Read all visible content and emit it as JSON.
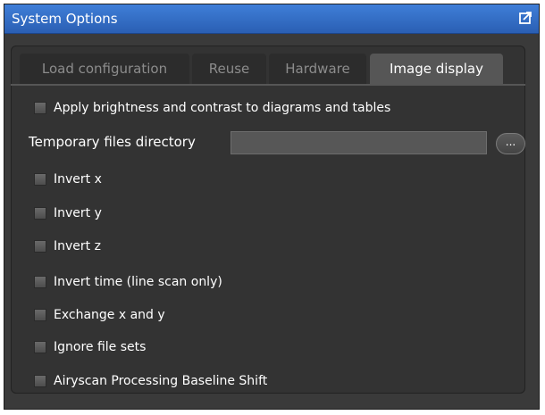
{
  "window": {
    "title": "System Options",
    "undock_icon": "undock-icon"
  },
  "tabs": [
    {
      "label": "Load configuration",
      "active": false
    },
    {
      "label": "Reuse",
      "active": false
    },
    {
      "label": "Hardware",
      "active": false
    },
    {
      "label": "Image display",
      "active": true
    }
  ],
  "options": {
    "apply_brightness": {
      "label": "Apply brightness and contrast to diagrams and tables",
      "checked": false
    },
    "temp_dir": {
      "label": "Temporary files directory",
      "value": "",
      "browse_label": "..."
    },
    "invert_x": {
      "label": "Invert x",
      "checked": false
    },
    "invert_y": {
      "label": "Invert y",
      "checked": false
    },
    "invert_z": {
      "label": "Invert z",
      "checked": false
    },
    "invert_time": {
      "label": "Invert time (line scan only)",
      "checked": false
    },
    "exchange_xy": {
      "label": "Exchange x and y",
      "checked": false
    },
    "ignore_file_sets": {
      "label": "Ignore file sets",
      "checked": false
    },
    "airyscan_shift": {
      "label": "Airyscan Processing Baseline Shift",
      "checked": false
    }
  }
}
